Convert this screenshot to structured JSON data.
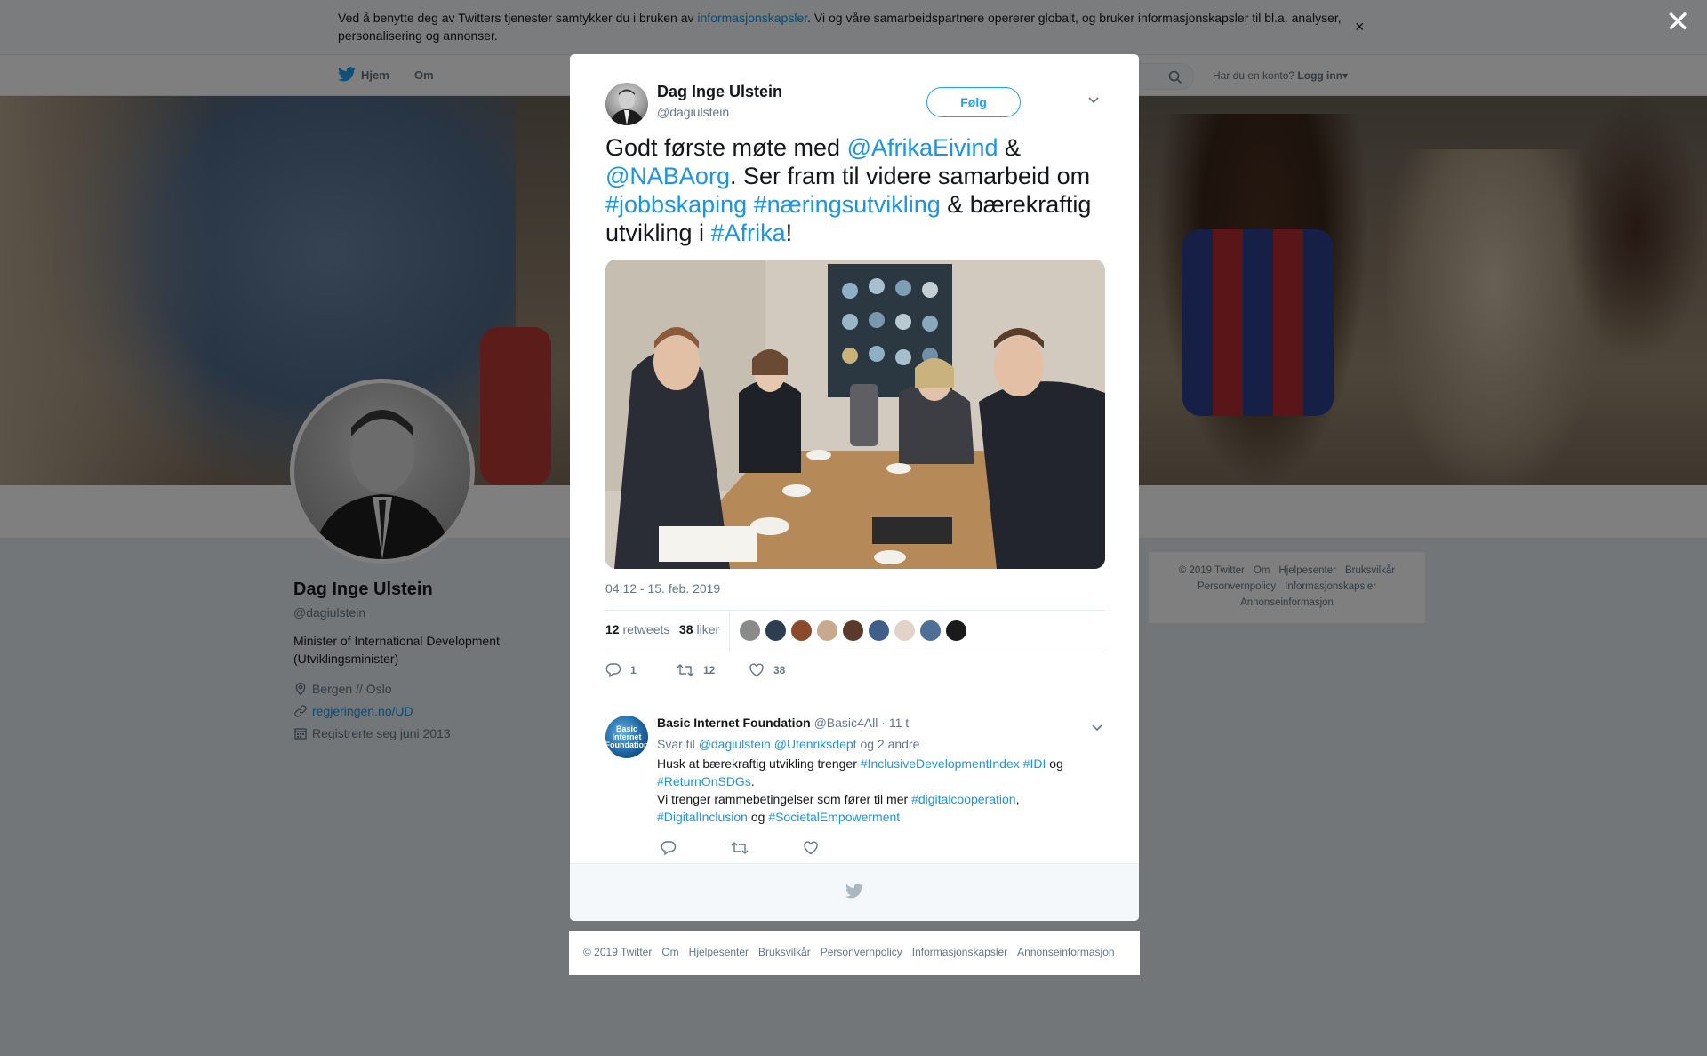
{
  "cookie": {
    "text_before": "Ved å benytte deg av Twitters tjenester samtykker du i bruken av ",
    "link": "informasjonskapsler",
    "text_after": ". Vi og våre samarbeidspartnere opererer globalt, og bruker informasjonskapsler til bl.a. analyser, personalisering og annonser.",
    "close": "×"
  },
  "nav": {
    "home": "Hjem",
    "about": "Om",
    "have_account": "Har du en konto?",
    "login": "Logg inn"
  },
  "close_modal": "✕",
  "profile": {
    "name": "Dag Inge Ulstein",
    "handle": "@dagiulstein",
    "bio": "Minister of International Development (Utviklingsminister)",
    "location": "Bergen // Oslo",
    "url": "regjeringen.no/UD",
    "joined": "Registrerte seg juni 2013"
  },
  "right_footer": {
    "items": [
      "© 2019 Twitter",
      "Om",
      "Hjelpesenter",
      "Bruksvilkår",
      "Personvernpolicy",
      "Informasjonskapsler",
      "Annonseinformasjon"
    ]
  },
  "tweet": {
    "author_name": "Dag Inge Ulstein",
    "author_handle": "@dagiulstein",
    "follow_label": "Følg",
    "text": {
      "p1": "Godt første møte med ",
      "m1": "@AfrikaEivind",
      "p2": " & ",
      "m2": "@NABAorg",
      "p3": ". Ser fram til videre samarbeid om ",
      "h1": "#jobbskaping",
      "p4": " ",
      "h2": "#næringsutvikling",
      "p5": " & bærekraftig utvikling i ",
      "h3": "#Afrika",
      "p6": "!"
    },
    "time": "04:12 - 15. feb. 2019",
    "retweets_count": "12",
    "retweets_label": "retweets",
    "likes_count": "38",
    "likes_label": "liker",
    "reply_count": "1",
    "retweet_action_count": "12",
    "like_action_count": "38"
  },
  "reply": {
    "name": "Basic Internet Foundation",
    "handle": "@Basic4All",
    "age": "· 11 t",
    "avatar_text": "Basic Internet Foundation",
    "reply_to_prefix": "Svar til",
    "reply_to_1": "@dagiulstein",
    "reply_to_2": "@Utenriksdept",
    "reply_to_suffix": "og 2 andre",
    "l1a": "Husk at bærekraftig utvikling trenger ",
    "l1b": "#InclusiveDevelopmentIndex",
    "l1c": " ",
    "l1d": "#IDI",
    "l1e": " og ",
    "l1f": "#ReturnOnSDGs",
    "l1g": ".",
    "l2a": "Vi trenger rammebetingelser som fører til mer ",
    "l2b": "#digitalcooperation",
    "l2c": ", ",
    "l2d": "#DigitalInclusion",
    "l2e": " og ",
    "l2f": "#SocietalEmpowerment"
  },
  "modal_footer": {
    "items": [
      "© 2019 Twitter",
      "Om",
      "Hjelpesenter",
      "Bruksvilkår",
      "Personvernpolicy",
      "Informasjonskapsler",
      "Annonseinformasjon"
    ]
  },
  "colors": {
    "link": "#1b95e0",
    "twitter_blue": "#1da1f2",
    "muted": "#657786"
  }
}
